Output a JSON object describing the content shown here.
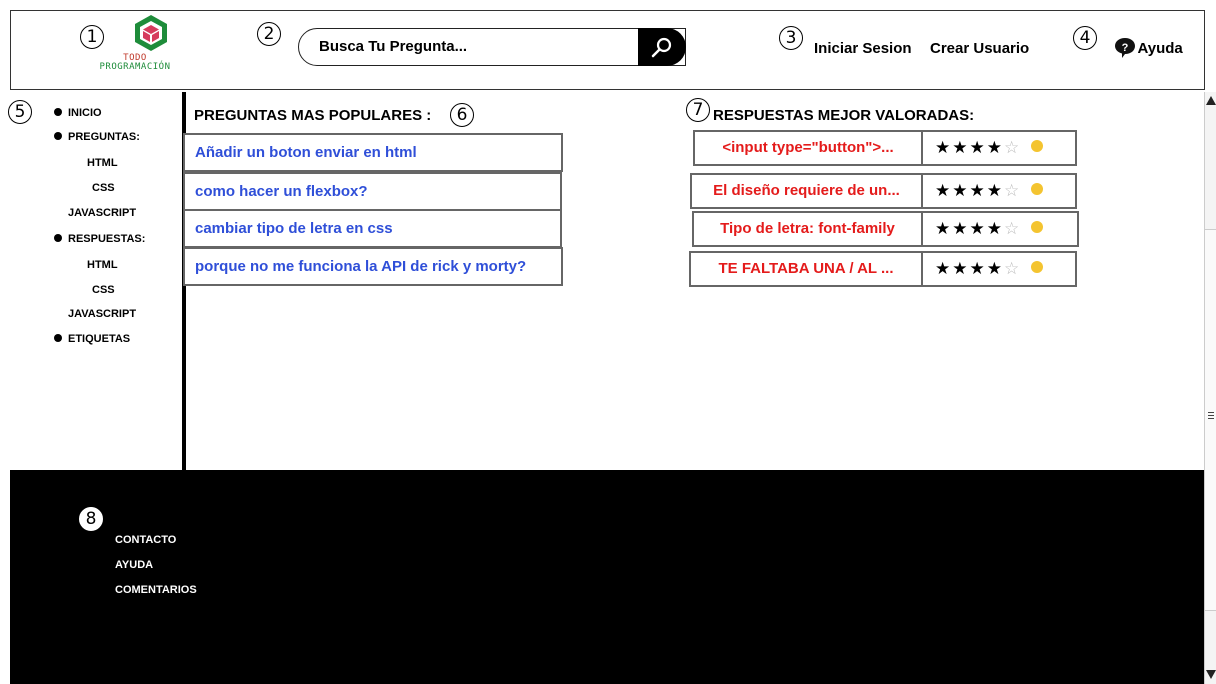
{
  "callouts": [
    "1",
    "2",
    "3",
    "4",
    "5",
    "6",
    "7",
    "8"
  ],
  "header": {
    "logo_line1": "TODO",
    "logo_line2": "PROGRAMACIÓN",
    "search_placeholder": "Busca Tu Pregunta...",
    "login": "Iniciar Sesion",
    "register": "Crear Usuario",
    "help": "Ayuda"
  },
  "sidebar": {
    "inicio": "INICIO",
    "preguntas": "PREGUNTAS:",
    "preguntas_items": [
      "HTML",
      "CSS",
      "JAVASCRIPT"
    ],
    "respuestas": "RESPUESTAS:",
    "respuestas_items": [
      "HTML",
      "CSS",
      "JAVASCRIPT"
    ],
    "etiquetas": "ETIQUETAS"
  },
  "popular": {
    "title": "PREGUNTAS MAS POPULARES :",
    "questions": [
      "Añadir un boton enviar en html",
      "como hacer un flexbox?",
      "cambiar tipo de letra en css",
      "porque no me funciona la API de rick y morty?"
    ]
  },
  "rated": {
    "title": "RESPUESTAS MEJOR VALORADAS:",
    "answers": [
      {
        "text": "<input type=\"button\">...",
        "stars": 4,
        "max": 5
      },
      {
        "text": "El diseño requiere de un...",
        "stars": 4,
        "max": 5
      },
      {
        "text": "Tipo de letra: font-family",
        "stars": 4,
        "max": 5
      },
      {
        "text": "TE FALTABA UNA / AL ...",
        "stars": 4,
        "max": 5
      }
    ]
  },
  "footer": {
    "links": [
      "CONTACTO",
      "AYUDA",
      "COMENTARIOS"
    ]
  },
  "colors": {
    "question_link": "#2f4fd8",
    "answer_text": "#e41b1b",
    "logo_green": "#1e8c3a",
    "logo_red": "#c0392b"
  }
}
